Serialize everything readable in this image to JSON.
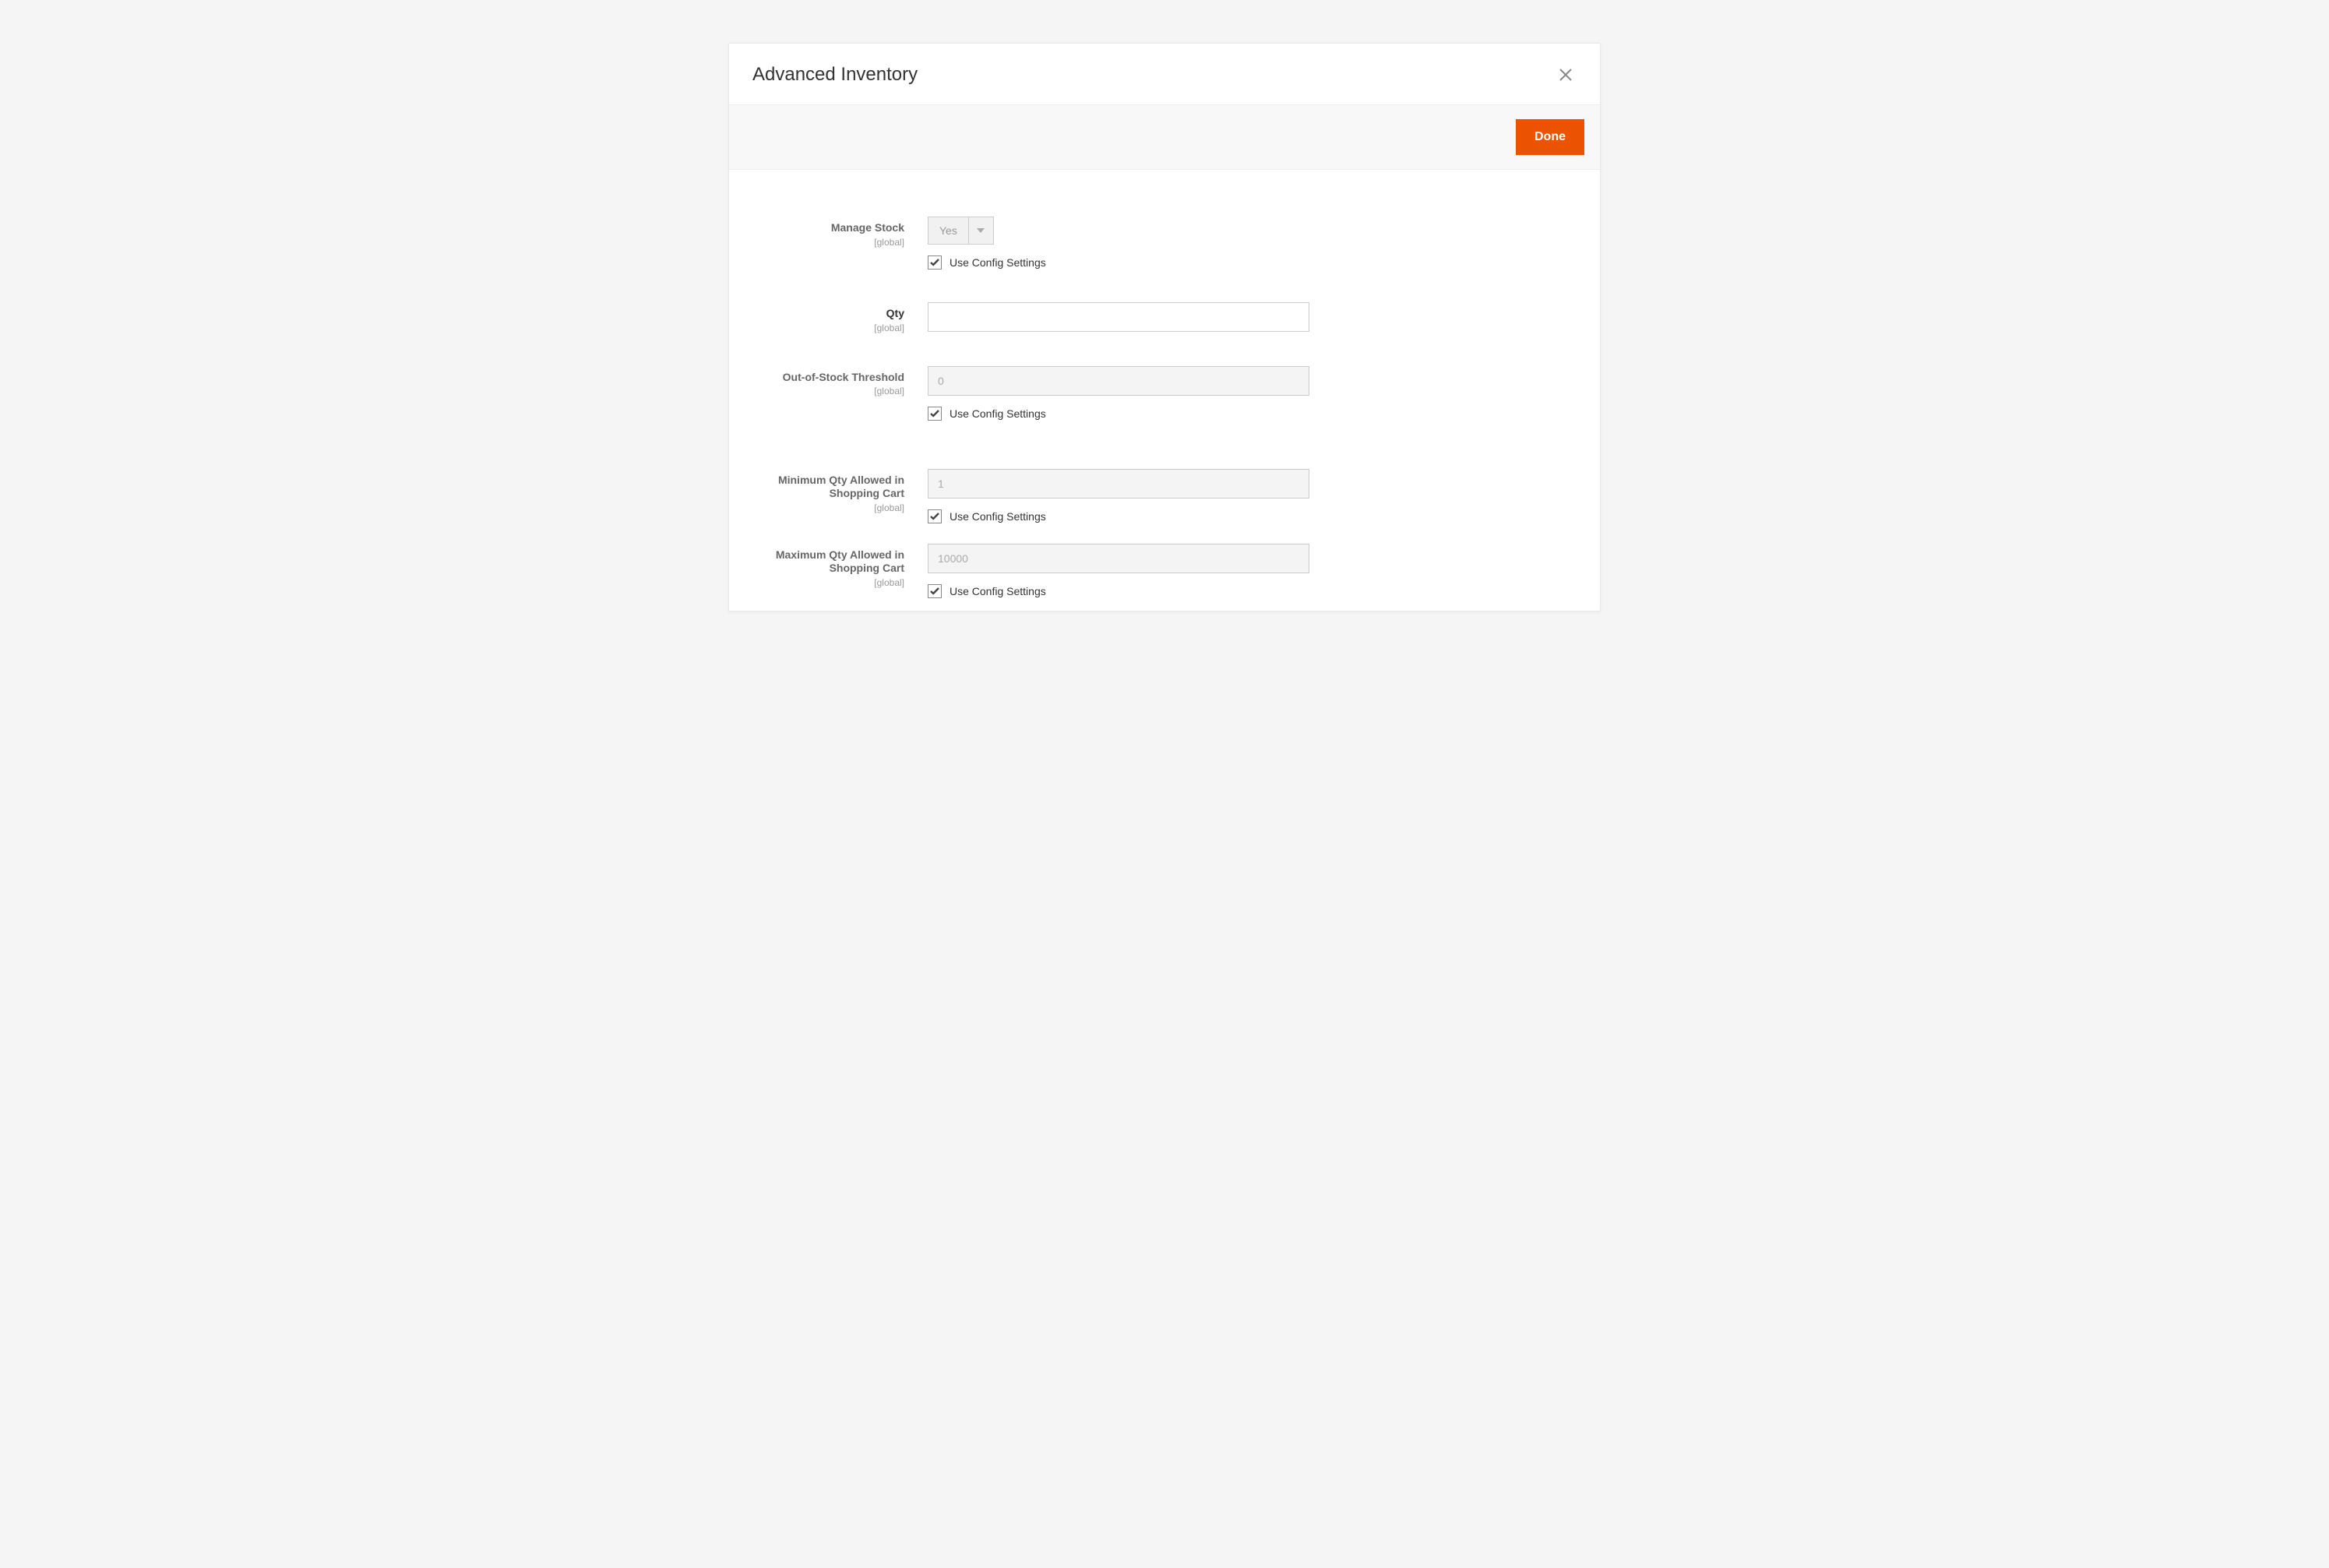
{
  "modal": {
    "title": "Advanced Inventory",
    "done_label": "Done"
  },
  "common": {
    "scope_global": "[global]",
    "use_config": "Use Config Settings"
  },
  "fields": {
    "manage_stock": {
      "label": "Manage Stock",
      "value": "Yes"
    },
    "qty": {
      "label": "Qty",
      "value": ""
    },
    "out_of_stock_threshold": {
      "label": "Out-of-Stock Threshold",
      "value": "0"
    },
    "min_qty_cart": {
      "label": "Minimum Qty Allowed in Shopping Cart",
      "value": "1"
    },
    "max_qty_cart": {
      "label": "Maximum Qty Allowed in Shopping Cart",
      "value": "10000"
    }
  }
}
